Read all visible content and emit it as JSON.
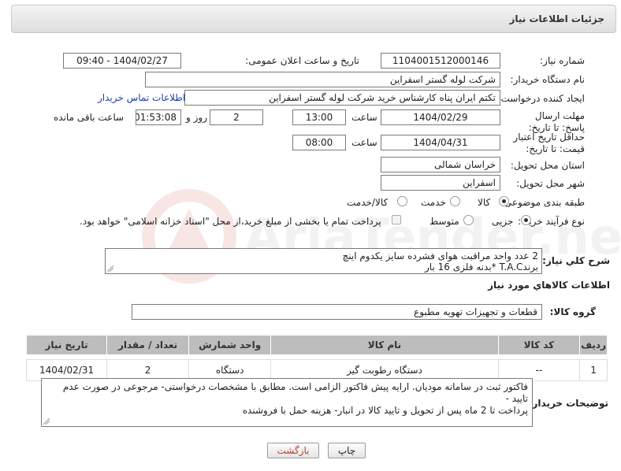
{
  "header": {
    "title": "جزئیات اطلاعات نیاز"
  },
  "fields": {
    "need_number_label": "شماره نیاز:",
    "need_number": "1104001512000146",
    "announce_label": "تاریخ و ساعت اعلان عمومی:",
    "announce_value": "1404/02/27 - 09:40",
    "buyer_org_label": "نام دستگاه خریدار:",
    "buyer_org": "شرکت لوله گستر اسفراین",
    "creator_label": "ایجاد کننده درخواست:",
    "creator": "تکتم ایران پناه کارشناس خرید شرکت لوله گستر اسفراین",
    "buyer_contact_link": "اطلاعات تماس خریدار",
    "deadline_label": "مهلت ارسال پاسخ: تا تاریخ:",
    "deadline_date": "1404/02/29",
    "time_label": "ساعت",
    "deadline_time": "13:00",
    "days": "2",
    "days_label": "روز و",
    "remaining_time": "01:53:08",
    "remaining_label": "ساعت باقی مانده",
    "validity_label": "حداقل تاریخ اعتبار قیمت: تا تاریخ:",
    "validity_date": "1404/04/31",
    "validity_time": "08:00",
    "province_label": "استان محل تحویل:",
    "province": "خراسان شمالی",
    "city_label": "شهر محل تحویل:",
    "city": "اسفراین",
    "category_label": "طبقه بندی موضوعی:",
    "category_options": [
      "کالا",
      "خدمت",
      "کالا/خدمت"
    ],
    "process_label": "نوع فرآیند خرید :",
    "process_options": [
      "جزیی",
      "متوسط"
    ],
    "payment_note": "پرداخت تمام یا بخشی از مبلغ خرید،از محل \"اسناد خزانه اسلامی\" خواهد بود.",
    "description_label": "شرح کلي نياز:",
    "description_line1": "2 عدد واحد مراقبت هوای فشرده سایز یکدوم اینچ",
    "description_line2": "برندT.A.C *بدنه فلزی 16 بار",
    "goods_info_title": "اطلاعات کالاهاي مورد نياز",
    "goods_group_label": "گروه کالا:",
    "goods_group": "قطعات و تجهیزات تهویه مطبوع"
  },
  "table": {
    "headers": [
      "ردیف",
      "کد کالا",
      "نام کالا",
      "واحد شمارش",
      "تعداد / مقدار",
      "تاریخ نیاز"
    ],
    "rows": [
      [
        "1",
        "--",
        "دستگاه رطوبت گیر",
        "دستگاه",
        "2",
        "1404/02/31"
      ]
    ]
  },
  "buyer_notes": {
    "label": "توضیحات خریدار:",
    "line1": "فاکتور ثبت در سامانه مودیان. ارایه پیش فاکتور الزامی است. مطابق با مشخصات درخواستی- مرجوعی در صورت عدم تایید -",
    "line2": "پرداخت تا 2 ماه پس از تحویل و تایید کالا در انبار- هزینه حمل با فروشنده"
  },
  "buttons": {
    "print": "چاپ",
    "back": "بازگشت"
  },
  "watermark": {
    "text": "AriaTender.neT"
  },
  "colors": {
    "link": "#1a3fa8",
    "back_button_text": "#c0392b"
  }
}
